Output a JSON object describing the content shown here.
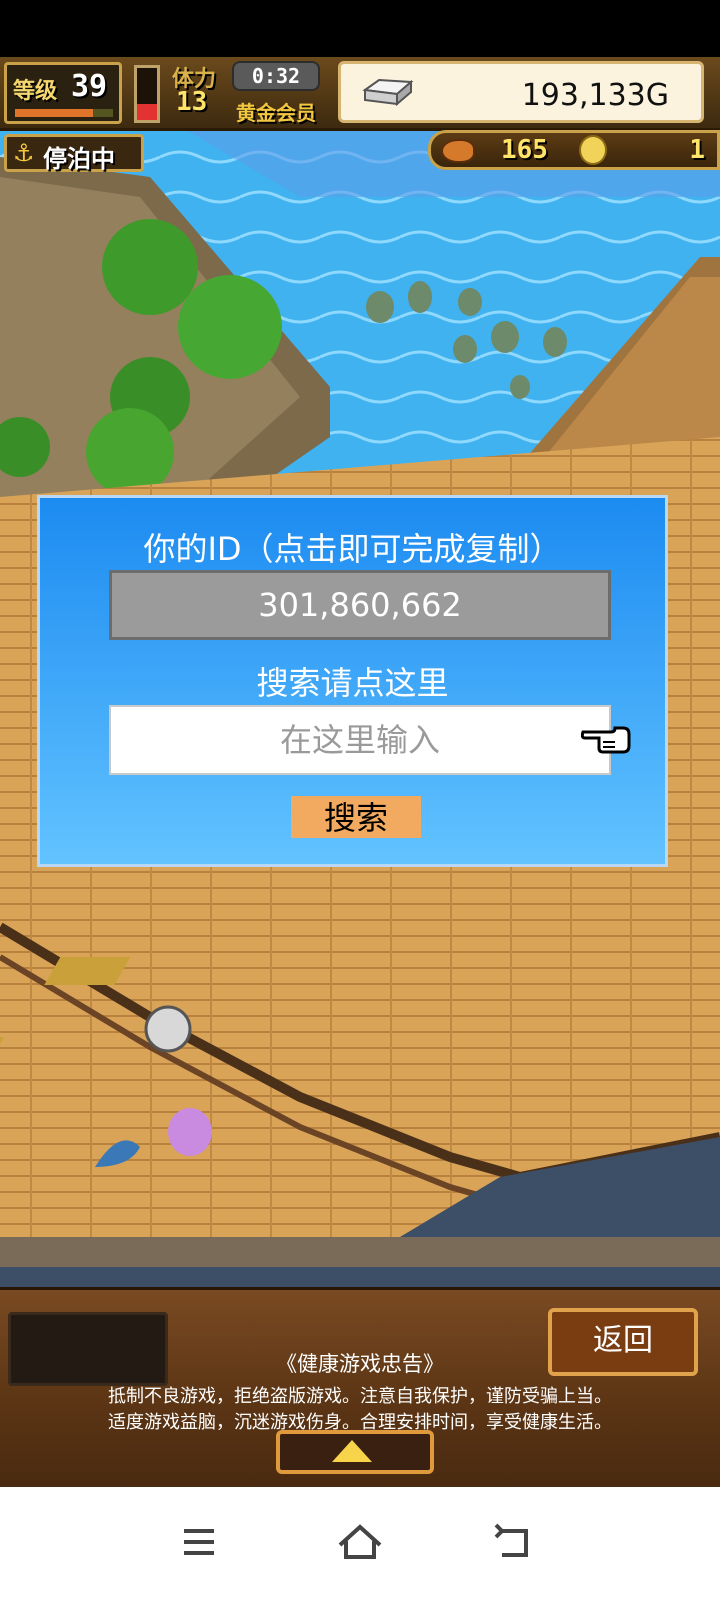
{
  "hud": {
    "level_label": "等级",
    "level_value": "39",
    "level_progress": 0.8,
    "stamina_label": "体力",
    "stamina_value": "13",
    "stamina_fill": 0.3,
    "timer": "0:32",
    "member_label": "黄金会员",
    "gold": "193,133G",
    "harbor_status": "停泊中",
    "food_value": "165",
    "medal_value": "1"
  },
  "dialog": {
    "title": "你的ID（点击即可完成复制）",
    "id_value": "301,860,662",
    "search_hint": "搜索请点这里",
    "search_placeholder": "在这里输入",
    "search_button": "搜索"
  },
  "bottom": {
    "back_button": "返回",
    "notice_title": "《健康游戏忠告》",
    "notice_line1": "抵制不良游戏，拒绝盗版游戏。注意自我保护，谨防受骗上当。",
    "notice_line2": "适度游戏益脑，沉迷游戏伤身。合理安排时间，享受健康生活。"
  },
  "icons": {
    "anchor": "anchor-icon",
    "food": "fish-food-icon",
    "medal": "medal-icon",
    "gold": "silver-bar-icon",
    "pointer": "pointing-hand-icon",
    "expand": "up-arrow-icon",
    "nav_menu": "menu-icon",
    "nav_home": "home-icon",
    "nav_back": "back-icon"
  },
  "colors": {
    "dialog_top": "#1c8bf1",
    "dialog_bottom": "#62c3ff",
    "search_button": "#f1aa60",
    "id_box": "#9b9b9b"
  }
}
